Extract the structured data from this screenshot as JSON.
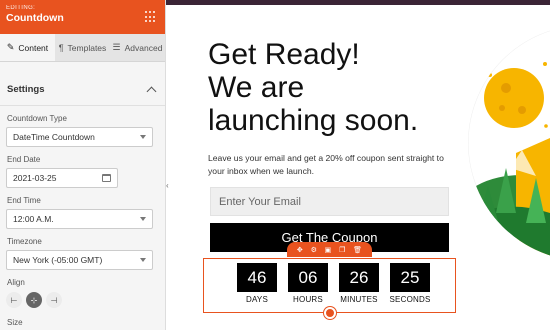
{
  "panel": {
    "editing_label": "EDITING:",
    "title": "Countdown",
    "tabs": [
      {
        "label": "Content",
        "icon": "pencil-icon"
      },
      {
        "label": "Templates",
        "icon": "paint-roller-icon"
      },
      {
        "label": "Advanced",
        "icon": "sliders-icon"
      }
    ],
    "section_title": "Settings",
    "fields": {
      "countdown_type": {
        "label": "Countdown Type",
        "value": "DateTime Countdown"
      },
      "end_date": {
        "label": "End Date",
        "value": "2021-03-25"
      },
      "end_time": {
        "label": "End Time",
        "value": "12:00 A.M."
      },
      "timezone": {
        "label": "Timezone",
        "value": "New York (-05:00 GMT)"
      }
    },
    "align_label": "Align",
    "size_label": "Size"
  },
  "page": {
    "headline_line1": "Get Ready!",
    "headline_line2": "We are",
    "headline_line3": "launching soon.",
    "subtext": "Leave us your email and get a 20% off coupon sent straight to your inbox when we launch.",
    "email_placeholder": "Enter Your Email",
    "button_label": "Get The Coupon"
  },
  "countdown": {
    "units": [
      {
        "value": "46",
        "label": "DAYS"
      },
      {
        "value": "06",
        "label": "HOURS"
      },
      {
        "value": "26",
        "label": "MINUTES"
      },
      {
        "value": "25",
        "label": "SECONDS"
      }
    ]
  },
  "colors": {
    "accent": "#e8531f",
    "top_strip": "#3b2436"
  }
}
